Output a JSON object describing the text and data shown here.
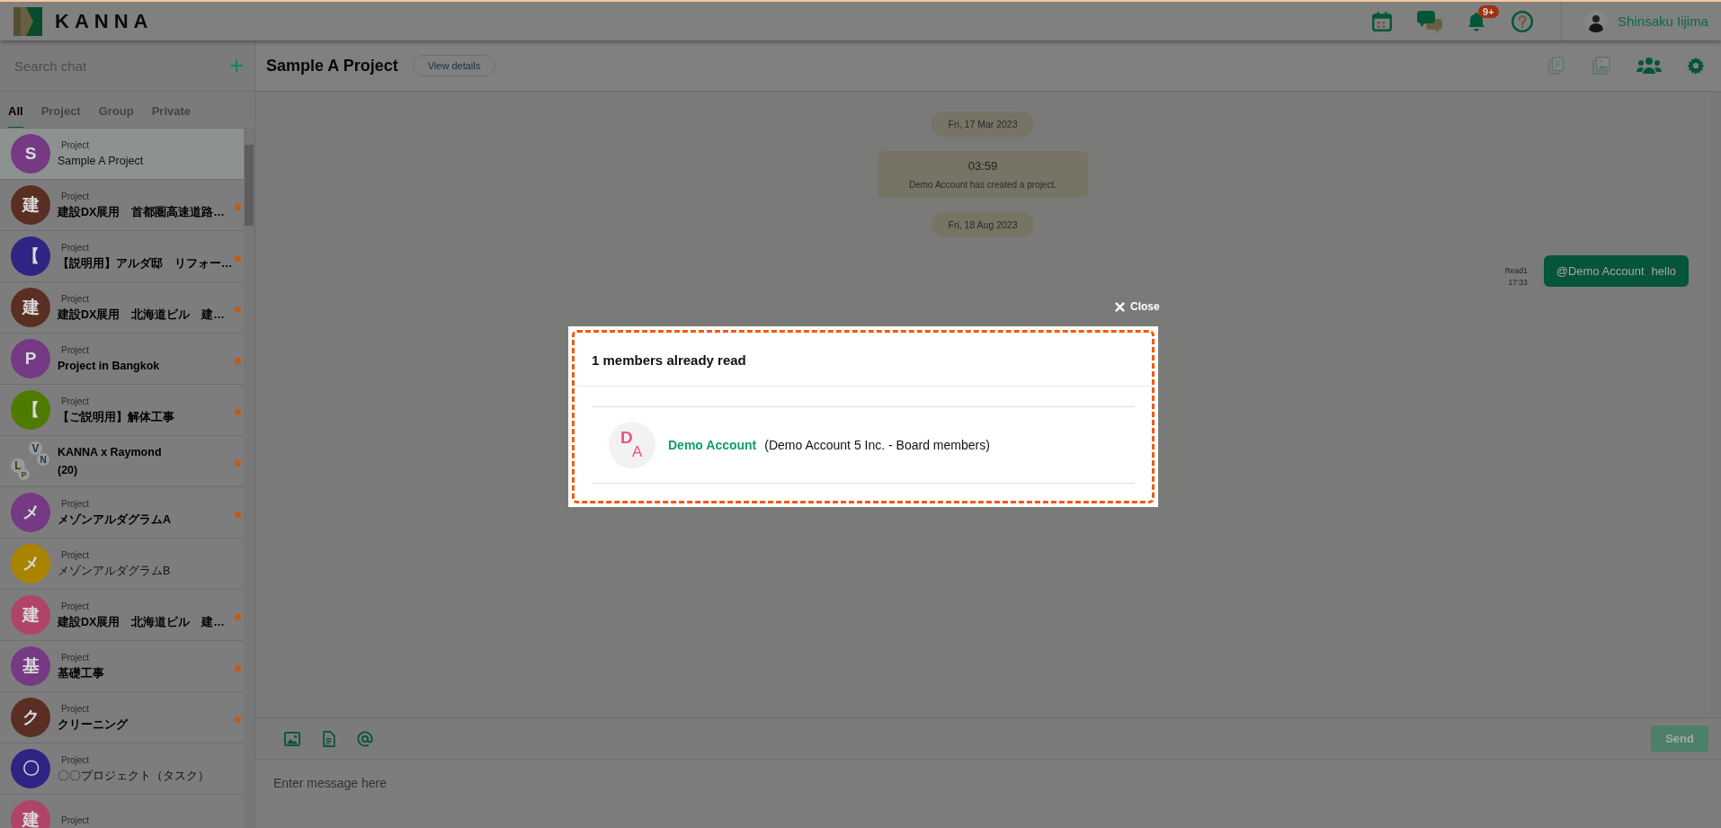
{
  "header": {
    "logo_text": "KANNA",
    "notifications_badge": "9+",
    "user_name": "Shinsaku Iijima"
  },
  "sidebar": {
    "search": {
      "placeholder": "Search chat"
    },
    "tabs": [
      {
        "label": "All",
        "selected": true
      },
      {
        "label": "Project",
        "selected": false
      },
      {
        "label": "Group",
        "selected": false
      },
      {
        "label": "Private",
        "selected": false
      }
    ],
    "items": [
      {
        "kind": "project",
        "label": "Project",
        "avatar": "S",
        "color": "#763a84",
        "name": "Sample A Project",
        "unread": false,
        "selected": true
      },
      {
        "kind": "project",
        "label": "Project",
        "avatar": "建",
        "color": "#5a2e22",
        "name": "建設DX展用　首都圏高速道路…",
        "unread": true,
        "selected": false
      },
      {
        "kind": "project",
        "label": "Project",
        "avatar": "【",
        "color": "#2e2484",
        "name": "【説明用】アルダ邸　リフォー…",
        "unread": true,
        "selected": false
      },
      {
        "kind": "project",
        "label": "Project",
        "avatar": "建",
        "color": "#5a2e22",
        "name": "建設DX展用　北海道ビル　建…",
        "unread": true,
        "selected": false
      },
      {
        "kind": "project",
        "label": "Project",
        "avatar": "P",
        "color": "#763a84",
        "name": "Project in Bangkok",
        "unread": true,
        "selected": false
      },
      {
        "kind": "project",
        "label": "Project",
        "avatar": "【",
        "color": "#4f7a00",
        "name": "【ご説明用】解体工事",
        "unread": true,
        "selected": false
      },
      {
        "kind": "group",
        "avatar_letters": [
          "V",
          "N",
          "L",
          "P"
        ],
        "name": "KANNA x Raymond",
        "count": "(20)",
        "unread": true,
        "selected": false
      },
      {
        "kind": "project",
        "label": "Project",
        "avatar": "メ",
        "color": "#763a84",
        "name": "メゾンアルダグラムA",
        "unread": true,
        "selected": false
      },
      {
        "kind": "project",
        "label": "Project",
        "avatar": "メ",
        "color": "#a88400",
        "name": "メゾンアルダグラムB",
        "unread": false,
        "selected": false
      },
      {
        "kind": "project",
        "label": "Project",
        "avatar": "建",
        "color": "#b04468",
        "name": "建設DX展用　北海道ビル　建…",
        "unread": true,
        "selected": false
      },
      {
        "kind": "project",
        "label": "Project",
        "avatar": "基",
        "color": "#763a84",
        "name": "基礎工事",
        "unread": true,
        "selected": false
      },
      {
        "kind": "project",
        "label": "Project",
        "avatar": "ク",
        "color": "#5a2e22",
        "name": "クリーニング",
        "unread": true,
        "selected": false
      },
      {
        "kind": "project",
        "label": "Project",
        "avatar": "〇",
        "color": "#2e2484",
        "name": "〇〇プロジェクト（タスク）",
        "unread": false,
        "selected": false
      },
      {
        "kind": "project",
        "label": "Project",
        "avatar": "建",
        "color": "#b04468",
        "unread": false,
        "selected": false
      }
    ]
  },
  "chat": {
    "title": "Sample A Project",
    "details_button": "View details",
    "toolbar": [
      {
        "kind": "documents",
        "disabled": true
      },
      {
        "kind": "images",
        "disabled": true
      },
      {
        "kind": "members",
        "disabled": false
      },
      {
        "kind": "settings",
        "disabled": false
      }
    ],
    "messages": [
      {
        "kind": "date",
        "text": "Fri, 17 Mar 2023"
      },
      {
        "kind": "system",
        "time": "03:59",
        "text": "Demo Account has created a project."
      },
      {
        "kind": "date",
        "text": "Fri, 18 Aug 2023"
      },
      {
        "kind": "outgoing",
        "read": "Read1",
        "time": "17:33",
        "mention": "@Demo Account",
        "text": "hello"
      }
    ],
    "composer": {
      "placeholder": "Enter message here",
      "send_label": "Send",
      "send_disabled": true
    }
  },
  "modal": {
    "close_label": "Close",
    "title": "1 members already read",
    "readers": [
      {
        "initials": [
          "D",
          "A"
        ],
        "name": "Demo Account",
        "detail": "(Demo Account 5 Inc. - Board members)"
      }
    ]
  }
}
